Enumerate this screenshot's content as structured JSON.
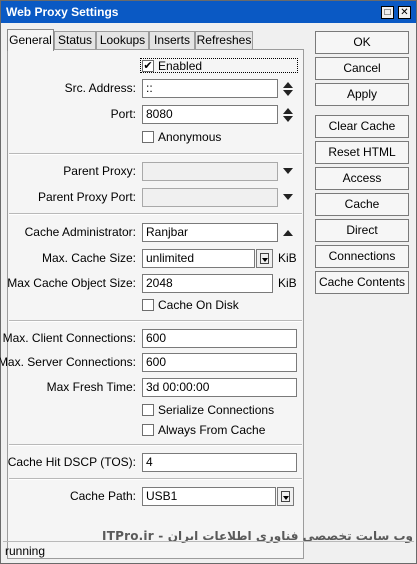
{
  "window": {
    "title": "Web Proxy Settings"
  },
  "title_buttons": {
    "restore": "□",
    "close": "✕"
  },
  "tabs": [
    "General",
    "Status",
    "Lookups",
    "Inserts",
    "Refreshes"
  ],
  "general": {
    "enabled_label": "Enabled",
    "enabled": true,
    "src_address": {
      "label": "Src. Address:",
      "value": "::"
    },
    "port": {
      "label": "Port:",
      "value": "8080"
    },
    "anonymous": {
      "label": "Anonymous",
      "checked": false
    },
    "parent_proxy": {
      "label": "Parent Proxy:",
      "value": ""
    },
    "parent_proxy_port": {
      "label": "Parent Proxy Port:",
      "value": ""
    },
    "cache_admin": {
      "label": "Cache Administrator:",
      "value": "Ranjbar"
    },
    "max_cache_size": {
      "label": "Max. Cache Size:",
      "value": "unlimited",
      "unit": "KiB"
    },
    "max_cache_object_size": {
      "label": "Max Cache Object Size:",
      "value": "2048",
      "unit": "KiB"
    },
    "cache_on_disk": {
      "label": "Cache On Disk",
      "checked": false
    },
    "max_client_connections": {
      "label": "Max. Client Connections:",
      "value": "600"
    },
    "max_server_connections": {
      "label": "Max. Server Connections:",
      "value": "600"
    },
    "max_fresh_time": {
      "label": "Max Fresh Time:",
      "value": "3d 00:00:00"
    },
    "serialize_connections": {
      "label": "Serialize Connections",
      "checked": false
    },
    "always_from_cache": {
      "label": "Always From Cache",
      "checked": false
    },
    "cache_hit_dscp": {
      "label": "Cache Hit DSCP (TOS):",
      "value": "4"
    },
    "cache_path": {
      "label": "Cache Path:",
      "value": "USB1"
    }
  },
  "buttons": [
    "OK",
    "Cancel",
    "Apply",
    "Clear Cache",
    "Reset HTML",
    "Access",
    "Cache",
    "Direct",
    "Connections",
    "Cache Contents"
  ],
  "status": "running",
  "watermark": "ITPro.ir - وب سایت تخصصی فناوری اطلاعات ایران",
  "colors": {
    "titlebar": "#0a59c4",
    "panel": "#f5f5f5",
    "window": "#f0f0f0"
  },
  "icons": [
    "checkmark-icon",
    "spin-up-icon",
    "spin-down-icon",
    "dropdown-arrow-icon"
  ]
}
